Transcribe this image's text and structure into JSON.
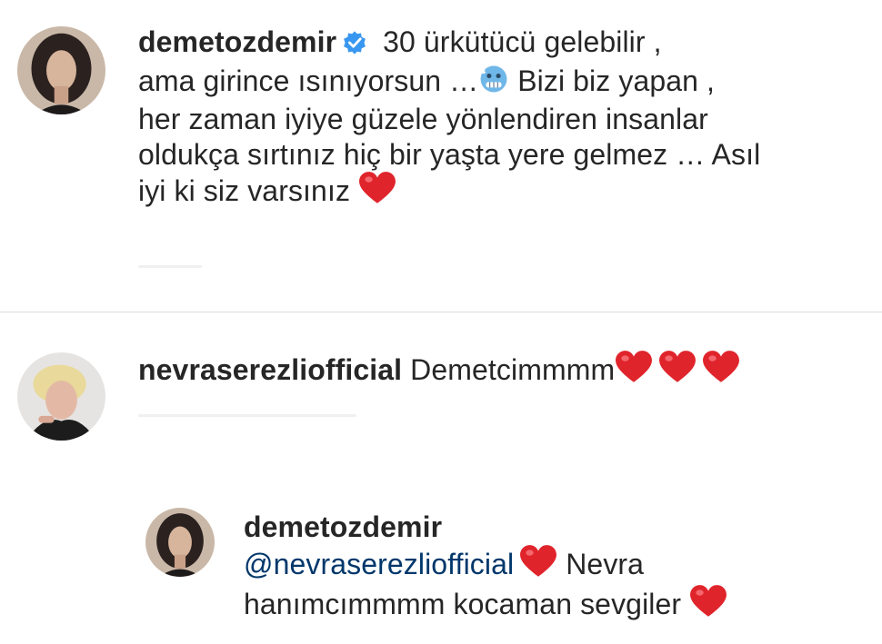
{
  "comment1": {
    "username": "demetozdemir",
    "verified_icon": "verified-badge-icon",
    "text_line1": " 30 ürkütücü gelebilir ,",
    "text_line2a": "ama girince ısınıyorsun …",
    "emoji": "cold-face-emoji-icon",
    "text_line2b": " Bizi biz yapan ,",
    "text_line3": "her zaman iyiye güzele yönlendiren insanlar",
    "text_line4": "oldukça sırtınız hiç bir yaşta yere gelmez … Asıl",
    "text_line5": "iyi ki siz varsınız ",
    "heart_icon": "red-heart-icon"
  },
  "comment2": {
    "username": "nevraserezliofficial",
    "text": " Demetcimmmm",
    "hearts": 3,
    "heart_icon": "red-heart-icon"
  },
  "reply": {
    "username": "demetozdemir",
    "mention": "@nevraserezliofficial",
    "text_after_mention": " Nevra",
    "text_line3": "hanımcımmmm kocaman sevgiler ",
    "heart_icon": "red-heart-icon"
  },
  "colors": {
    "text": "#262626",
    "mention": "#00376b",
    "verified": "#3897f0",
    "heart": "#e0242b",
    "divider": "#dbdbdb"
  }
}
